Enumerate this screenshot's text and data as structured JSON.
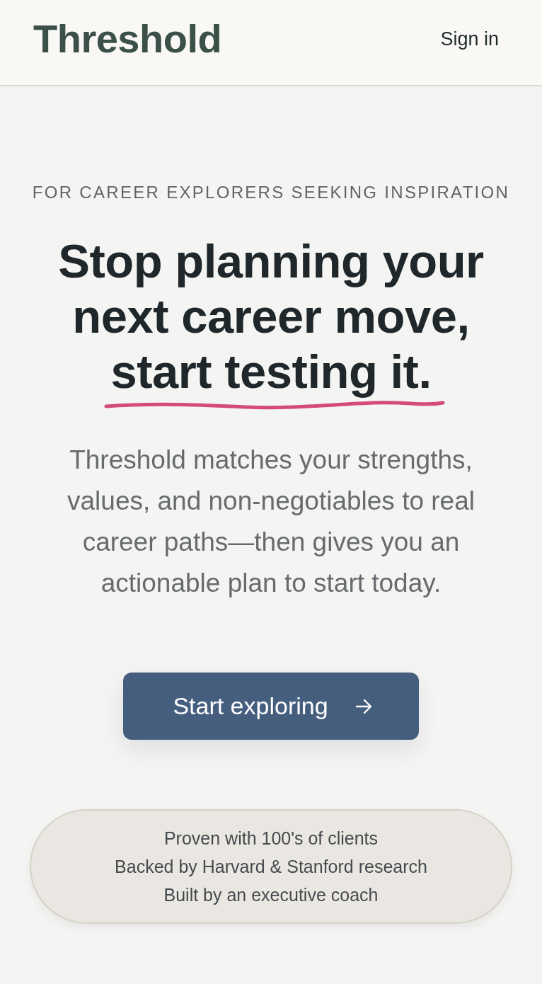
{
  "header": {
    "logo": "Threshold",
    "sign_in": "Sign in"
  },
  "hero": {
    "eyebrow": "FOR CAREER EXPLORERS SEEKING INSPIRATION",
    "headline": "Stop planning your next career move,",
    "headline_highlight": "start testing it.",
    "subtitle": "Threshold matches your strengths, values, and non-negotiables to real career paths—then gives you an actionable plan to start today.",
    "cta": {
      "label": "Start exploring"
    }
  },
  "proof_points": [
    "Proven with 100's of clients",
    "Backed by Harvard & Stanford research",
    "Built by an executive coach"
  ]
}
